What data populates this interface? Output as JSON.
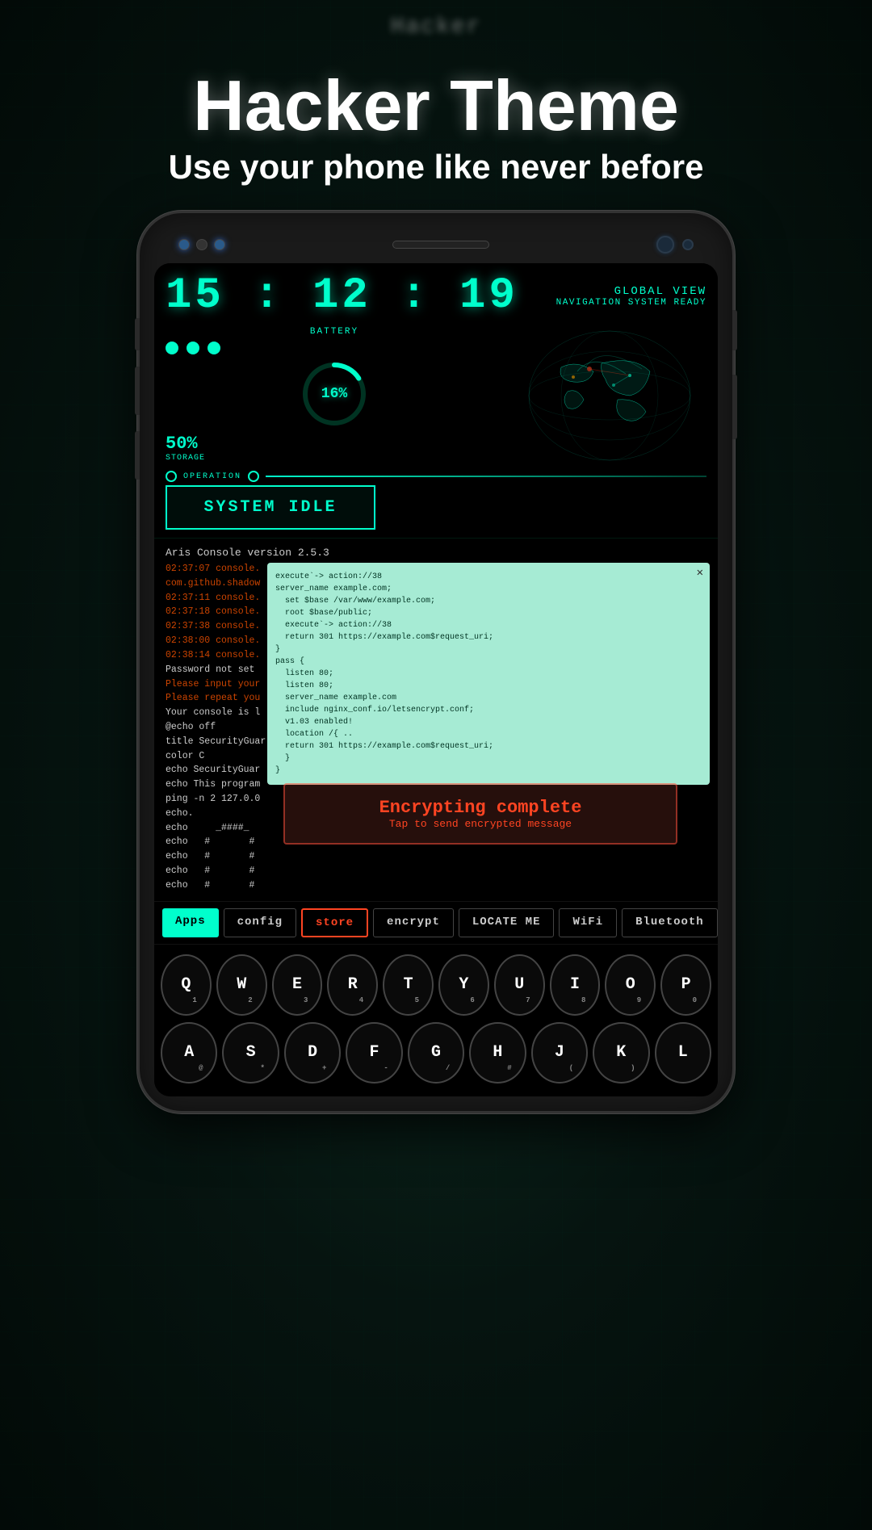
{
  "app": {
    "name_blurred": "Hacker"
  },
  "header": {
    "title": "Hacker Theme",
    "subtitle": "Use your phone like never before"
  },
  "phone": {
    "screen": {
      "clock": "15 : 12 : 19",
      "global_view_label": "GLOBAL VIEW",
      "nav_system_label": "NAVIGATION SYSTEM READY",
      "battery_label": "BATTERY",
      "battery_percent": "16%",
      "storage_percent": "50%",
      "storage_label": "STORAGE",
      "operation_label": "OPERATION",
      "system_idle_label": "SYSTEM IDLE"
    },
    "terminal": {
      "version_line": "Aris Console version 2.5.3",
      "lines": [
        {
          "time": "02:37:07",
          "label": "console.",
          "color": "red"
        },
        {
          "time": "",
          "label": "com.github.shadow",
          "color": "red"
        },
        {
          "time": "02:37:11",
          "label": "console.",
          "color": "red"
        },
        {
          "time": "02:37:18",
          "label": "console.",
          "color": "red"
        },
        {
          "time": "02:37:38",
          "label": "console.",
          "color": "red"
        },
        {
          "time": "02:38:00",
          "label": "console.",
          "color": "red"
        },
        {
          "time": "02:38:14",
          "label": "console.",
          "color": "red"
        },
        {
          "text": "Password not set",
          "color": "white"
        },
        {
          "text": "Please input your",
          "color": "red"
        },
        {
          "text": "Please repeat you",
          "color": "red"
        },
        {
          "text": "Your console is l",
          "color": "white"
        },
        {
          "text": "@echo off",
          "color": "white"
        },
        {
          "text": "title SecurityGuar",
          "color": "white"
        },
        {
          "text": "color C",
          "color": "white"
        },
        {
          "text": "echo SecurityGuar",
          "color": "white"
        },
        {
          "text": "echo This program",
          "color": "white"
        },
        {
          "text": "ping -n 2 127.0.0",
          "color": "white"
        },
        {
          "text": "echo.",
          "color": "white"
        },
        {
          "text": "echo    _####_",
          "color": "white"
        },
        {
          "text": "echo   #        #",
          "color": "white"
        },
        {
          "text": "echo   #        #",
          "color": "white"
        },
        {
          "text": "echo   #        #",
          "color": "white"
        },
        {
          "text": "echo   #        #",
          "color": "white"
        }
      ],
      "code_popup": {
        "lines": [
          "execute`-> action://38",
          "server_name example.com;",
          "  set $base /var/www/example.com;",
          "  root $base/public;",
          "  execute`-> action://38",
          "  return 301 https://example.com$request_uri;",
          "}",
          "pass {",
          "  listen 80;",
          "  listen 80;",
          "  server_name example.com",
          "  include nginx_conf.io/letsencrypt.conf;",
          "  v1.03 enabled!",
          "  location /{ ..",
          "  return 301 https://example.com$request_uri;",
          "  }",
          "}"
        ]
      },
      "encrypt_popup": {
        "main": "Encrypting complete",
        "sub": "Tap to send encrypted message"
      }
    },
    "tabs": [
      {
        "label": "Apps",
        "style": "active"
      },
      {
        "label": "config",
        "style": "default"
      },
      {
        "label": "store",
        "style": "red"
      },
      {
        "label": "encrypt",
        "style": "default"
      },
      {
        "label": "LOCATE ME",
        "style": "default"
      },
      {
        "label": "WiFi",
        "style": "default"
      },
      {
        "label": "Bluetooth",
        "style": "default"
      }
    ],
    "keyboard": {
      "rows": [
        [
          {
            "key": "Q",
            "sub": "1"
          },
          {
            "key": "W",
            "sub": "2"
          },
          {
            "key": "E",
            "sub": "3"
          },
          {
            "key": "R",
            "sub": "4"
          },
          {
            "key": "T",
            "sub": "5"
          },
          {
            "key": "Y",
            "sub": "6"
          },
          {
            "key": "U",
            "sub": "7"
          },
          {
            "key": "I",
            "sub": "8"
          },
          {
            "key": "O",
            "sub": "9"
          },
          {
            "key": "P",
            "sub": "0"
          }
        ],
        [
          {
            "key": "A",
            "sub": "@"
          },
          {
            "key": "S",
            "sub": "*"
          },
          {
            "key": "D",
            "sub": "+"
          },
          {
            "key": "F",
            "sub": "-"
          },
          {
            "key": "G",
            "sub": "/"
          },
          {
            "key": "H",
            "sub": "#"
          },
          {
            "key": "J",
            "sub": "("
          },
          {
            "key": "K",
            "sub": ")"
          },
          {
            "key": "L",
            "sub": ""
          }
        ]
      ]
    }
  }
}
